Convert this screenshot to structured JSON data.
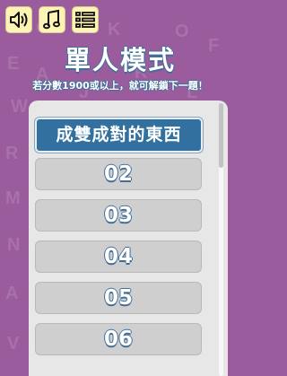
{
  "header": {
    "title": "單人模式",
    "subtitle": "若分數1900或以上，就可解鎖下一題！"
  },
  "toolbar": {
    "sound_icon": "speaker-icon",
    "music_icon": "music-note-icon",
    "menu_icon": "list-menu-icon"
  },
  "category": {
    "label": "成雙成對的東西"
  },
  "levels": [
    "02",
    "03",
    "04",
    "05",
    "06"
  ],
  "colors": {
    "background": "#9a5c9c",
    "button_yellow": "#fdf3b4",
    "header_blue": "#32719f",
    "level_gray": "#cfcfcf"
  }
}
